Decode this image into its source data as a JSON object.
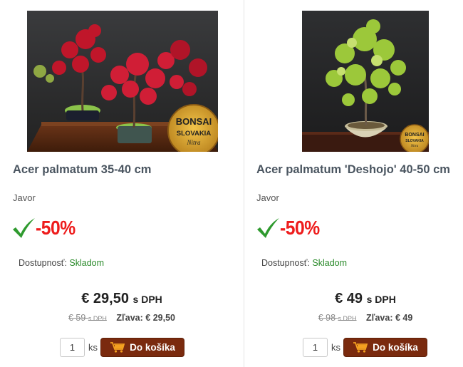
{
  "products": [
    {
      "name": "Acer palmatum 35-40 cm",
      "subname": "Javor",
      "discount": "-50%",
      "stock_label": "Dostupnosť:",
      "stock_value": "Skladom",
      "price": "€ 29,50",
      "price_unit": "s DPH",
      "old_price": "€ 59",
      "old_price_unit": "s DPH",
      "savings": "Zľava: € 29,50",
      "qty": "1",
      "qty_unit": "ks",
      "button": "Do košíka",
      "badge": {
        "line1": "BONSAI",
        "line2": "SLOVAKIA",
        "line3": "Nitra"
      }
    },
    {
      "name": "Acer palmatum 'Deshojo' 40-50 cm",
      "subname": "Javor",
      "discount": "-50%",
      "stock_label": "Dostupnosť:",
      "stock_value": "Skladom",
      "price": "€ 49",
      "price_unit": "s DPH",
      "old_price": "€ 98",
      "old_price_unit": "s DPH",
      "savings": "Zľava: € 49",
      "qty": "1",
      "qty_unit": "ks",
      "button": "Do košíka",
      "badge": {
        "line1": "BONSAI",
        "line2": "SLOVAKIA",
        "line3": "Nitra"
      }
    }
  ],
  "colors": {
    "discount_red": "#ee1c1c",
    "check_green": "#2e9a2e",
    "stock_green": "#2a8a2a",
    "button_brown": "#7a2a0e"
  },
  "icons": [
    "check-icon",
    "cart-icon"
  ]
}
